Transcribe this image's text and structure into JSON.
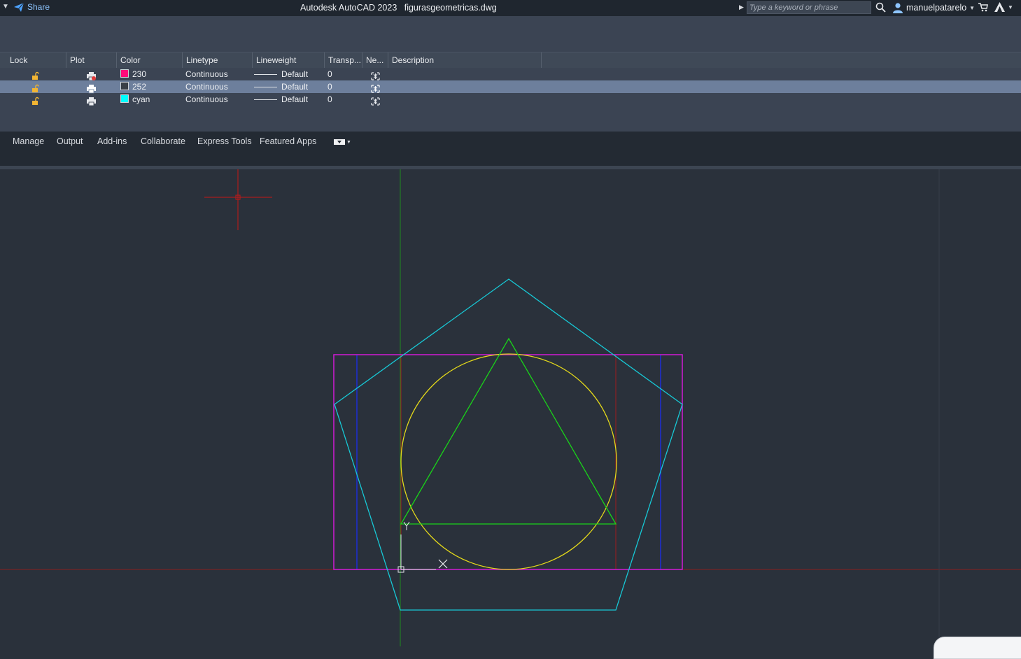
{
  "titlebar": {
    "share_label": "Share",
    "app_title": "Autodesk AutoCAD 2023",
    "file_name": "figurasgeometricas.dwg",
    "search_placeholder": "Type a keyword or phrase",
    "username": "manuelpatarelo"
  },
  "layers": {
    "columns": [
      "Lock",
      "Plot",
      "Color",
      "Linetype",
      "Lineweight",
      "Transp...",
      "Ne...",
      "Description"
    ],
    "rows": [
      {
        "color_name": "230",
        "color_hex": "#ff0a7a",
        "linetype": "Continuous",
        "lineweight": "Default",
        "transparency": "0",
        "selected": false
      },
      {
        "color_name": "252",
        "color_hex": "#3a3f46",
        "linetype": "Continuous",
        "lineweight": "Default",
        "transparency": "0",
        "selected": true
      },
      {
        "color_name": "cyan",
        "color_hex": "#00ffff",
        "linetype": "Continuous",
        "lineweight": "Default",
        "transparency": "0",
        "selected": false
      }
    ]
  },
  "ribbon": {
    "tabs": [
      "Manage",
      "Output",
      "Add-ins",
      "Collaborate",
      "Express Tools",
      "Featured Apps"
    ]
  },
  "drawing": {
    "colors": {
      "pentagon": "#17c9d6",
      "rectangle": "#d11ad6",
      "circle": "#e4d91a",
      "triangle": "#19d419",
      "blue_lines": "#1d2ed6",
      "red_lines": "#a01c1c",
      "crosshair": "#c81616",
      "y_axis": "#1f8a1f",
      "x_axis": "#8a1f1f"
    }
  }
}
